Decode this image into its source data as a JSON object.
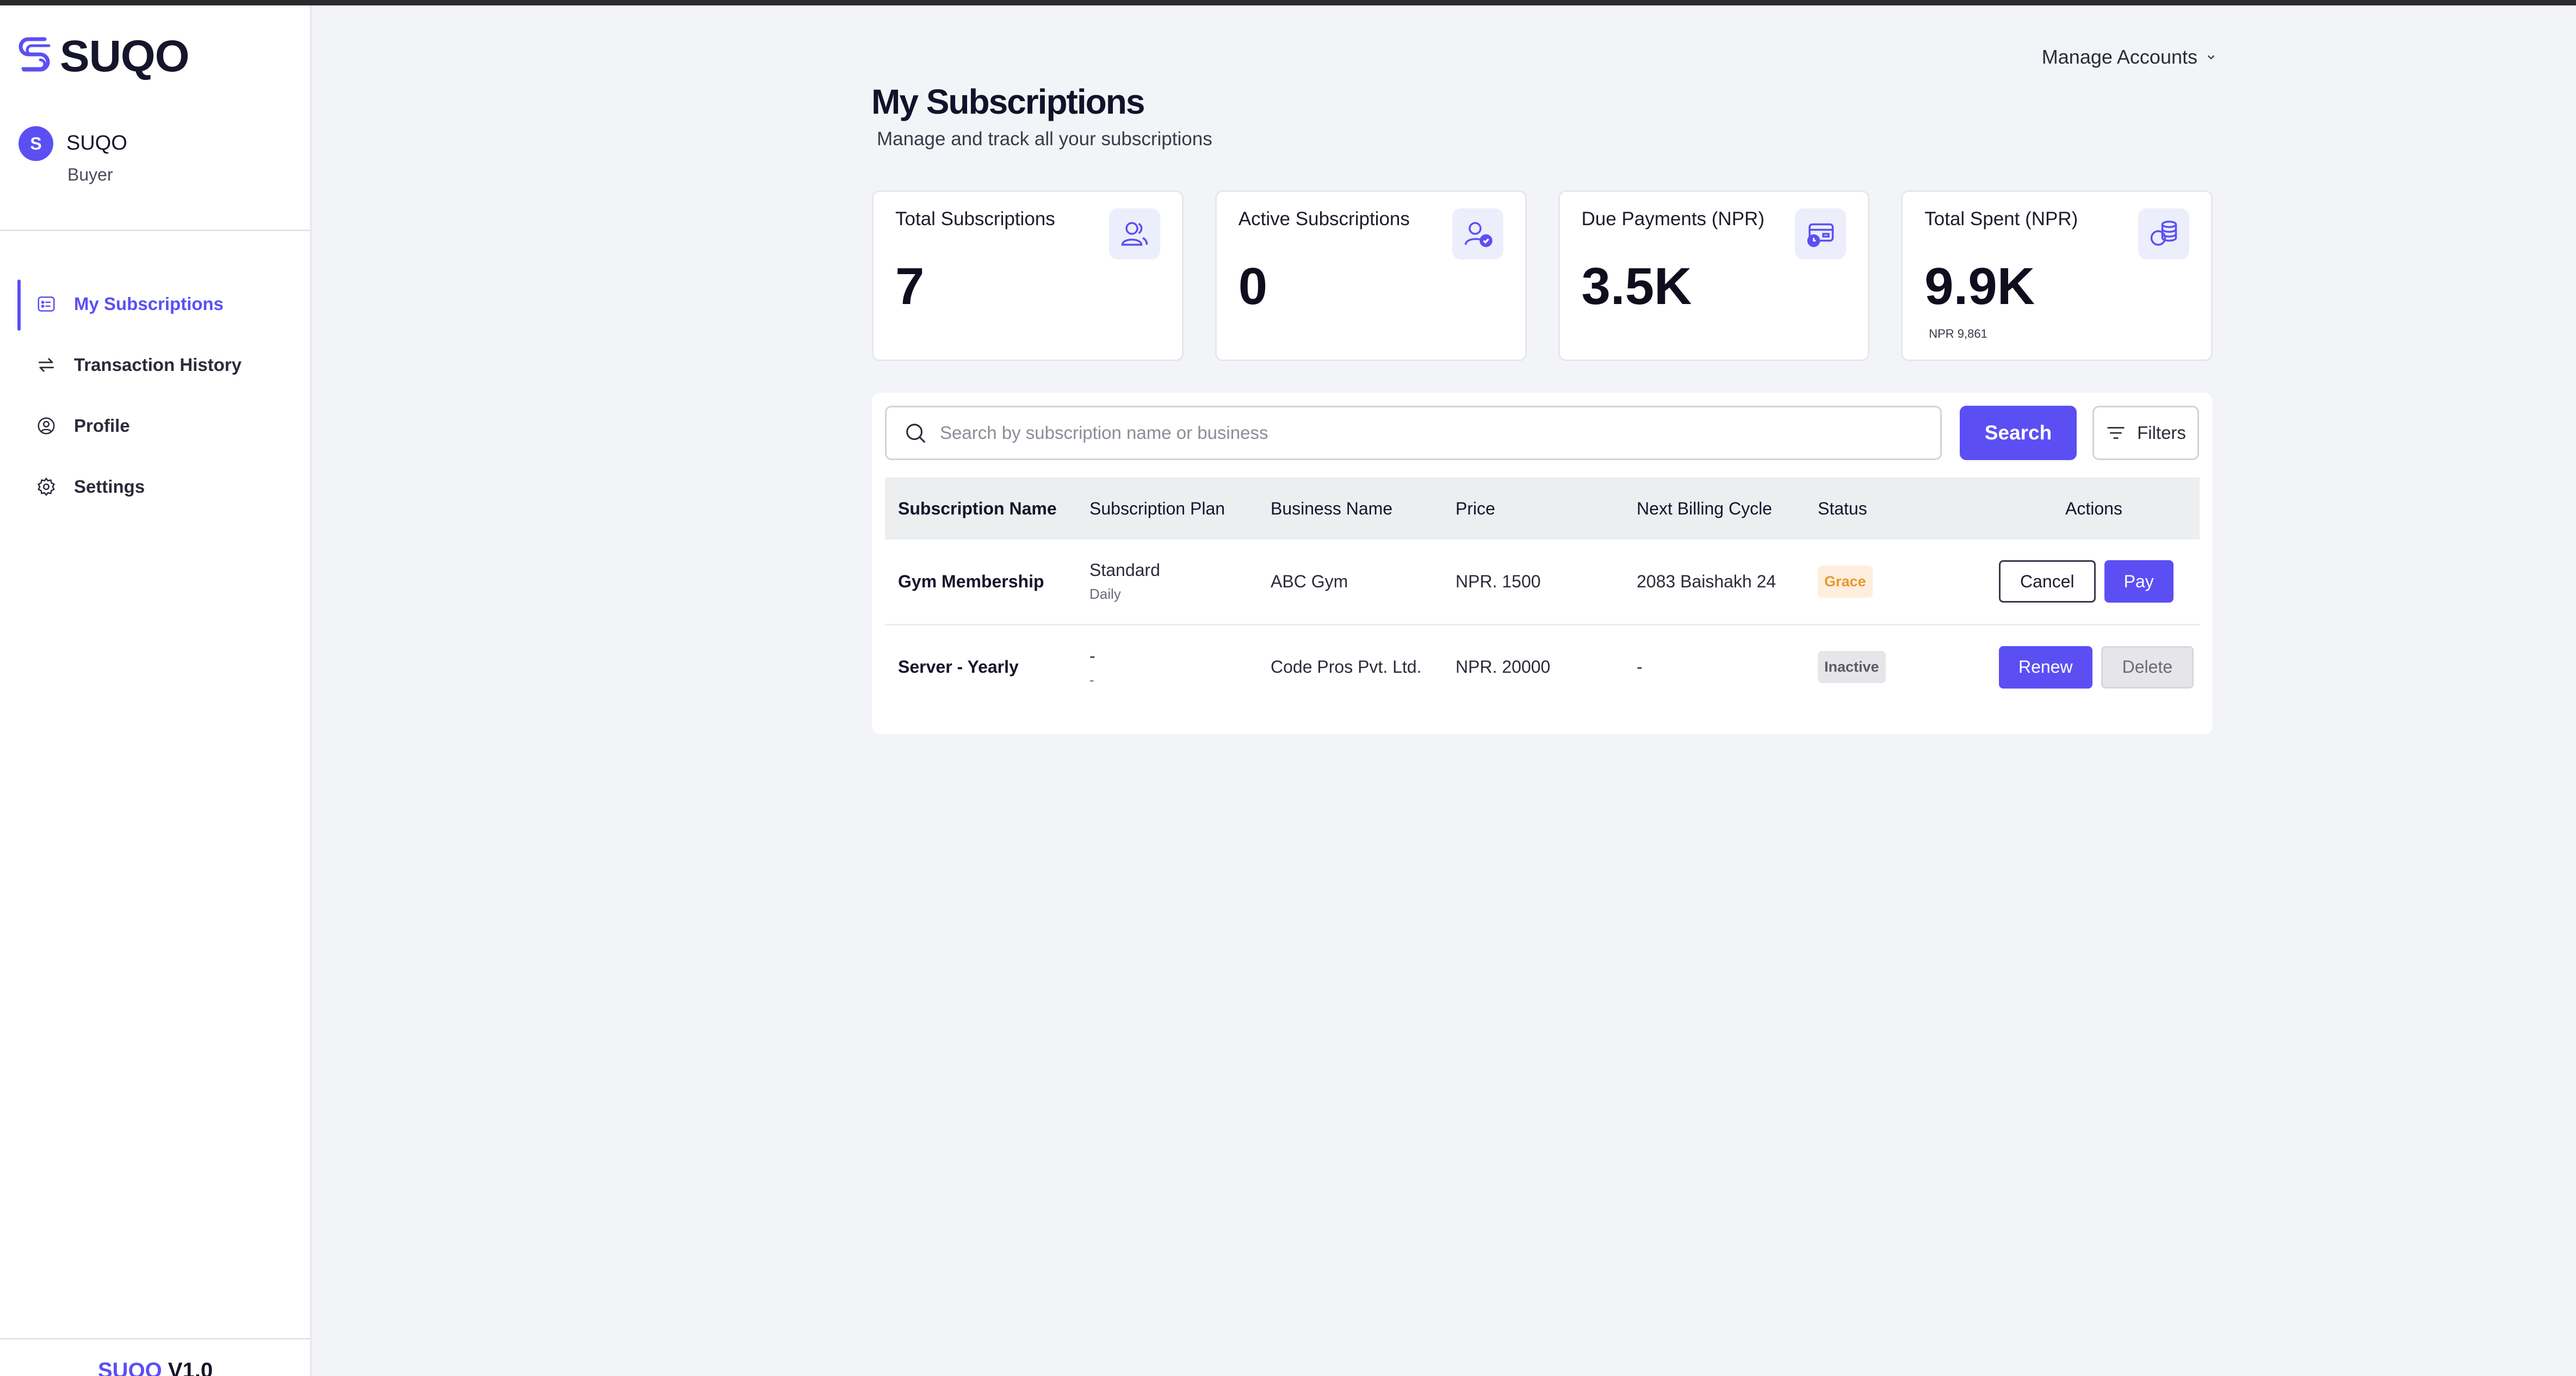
{
  "brand": {
    "name": "SUQO",
    "accent": "#5b4ff4"
  },
  "user": {
    "initial": "S",
    "name": "SUQO",
    "role": "Buyer"
  },
  "sidebar": {
    "items": [
      {
        "label": "My Subscriptions",
        "icon": "subscriptions-icon",
        "active": true
      },
      {
        "label": "Transaction History",
        "icon": "swap-arrows-icon"
      },
      {
        "label": "Profile",
        "icon": "user-circle-icon"
      },
      {
        "label": "Settings",
        "icon": "gear-icon"
      }
    ],
    "version_brand": "SUQO",
    "version_num": "V1.0"
  },
  "header": {
    "manage_accounts": "Manage Accounts",
    "title": "My Subscriptions",
    "subtitle": "Manage and track all your subscriptions"
  },
  "stats": [
    {
      "label": "Total Subscriptions",
      "value": "7",
      "icon": "users-icon"
    },
    {
      "label": "Active Subscriptions",
      "value": "0",
      "icon": "user-check-icon"
    },
    {
      "label": "Due Payments (NPR)",
      "value": "3.5K",
      "icon": "card-clock-icon"
    },
    {
      "label": "Total Spent (NPR)",
      "value": "9.9K",
      "note": "NPR 9,861",
      "icon": "coins-icon"
    }
  ],
  "search": {
    "placeholder": "Search by subscription name or business",
    "button": "Search",
    "filters": "Filters"
  },
  "table": {
    "columns": [
      "Subscription Name",
      "Subscription Plan",
      "Business Name",
      "Price",
      "Next Billing Cycle",
      "Status",
      "Actions"
    ],
    "rows": [
      {
        "name": "Gym Membership",
        "plan": "Standard",
        "plan_period": "Daily",
        "business": "ABC Gym",
        "price": "NPR. 1500",
        "next_billing": "2083 Baishakh 24",
        "status": "Grace",
        "actions": [
          "Cancel",
          "Pay"
        ]
      },
      {
        "name": "Server - Yearly",
        "plan": "-",
        "plan_period": "-",
        "business": "Code Pros Pvt. Ltd.",
        "price": "NPR. 20000",
        "next_billing": "-",
        "status": "Inactive",
        "actions": [
          "Renew",
          "Delete"
        ]
      }
    ]
  }
}
